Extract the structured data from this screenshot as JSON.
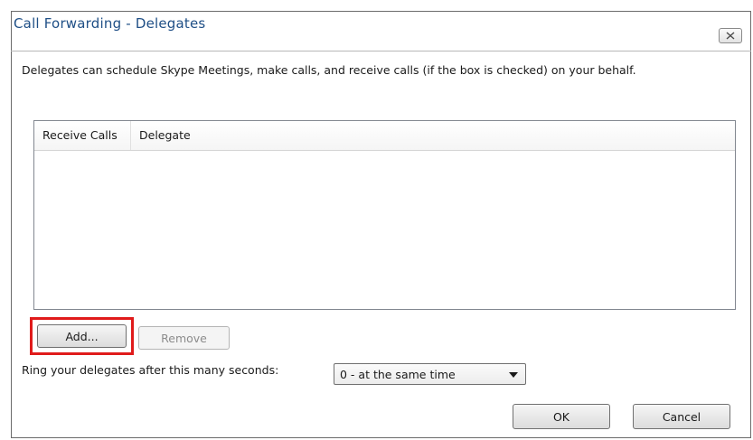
{
  "window": {
    "title": "Call Forwarding - Delegates",
    "close_icon": "close-icon"
  },
  "description": "Delegates can schedule Skype Meetings, make calls, and receive calls (if the box is checked) on your behalf.",
  "delegates_table": {
    "columns": [
      "Receive Calls",
      "Delegate"
    ],
    "rows": []
  },
  "buttons": {
    "add": "Add...",
    "remove": "Remove",
    "ok": "OK",
    "cancel": "Cancel"
  },
  "ring": {
    "label": "Ring your delegates after this many seconds:",
    "selected": "0 - at the same time"
  },
  "colors": {
    "title_text": "#1f4f86",
    "highlight": "#e01b1b"
  }
}
